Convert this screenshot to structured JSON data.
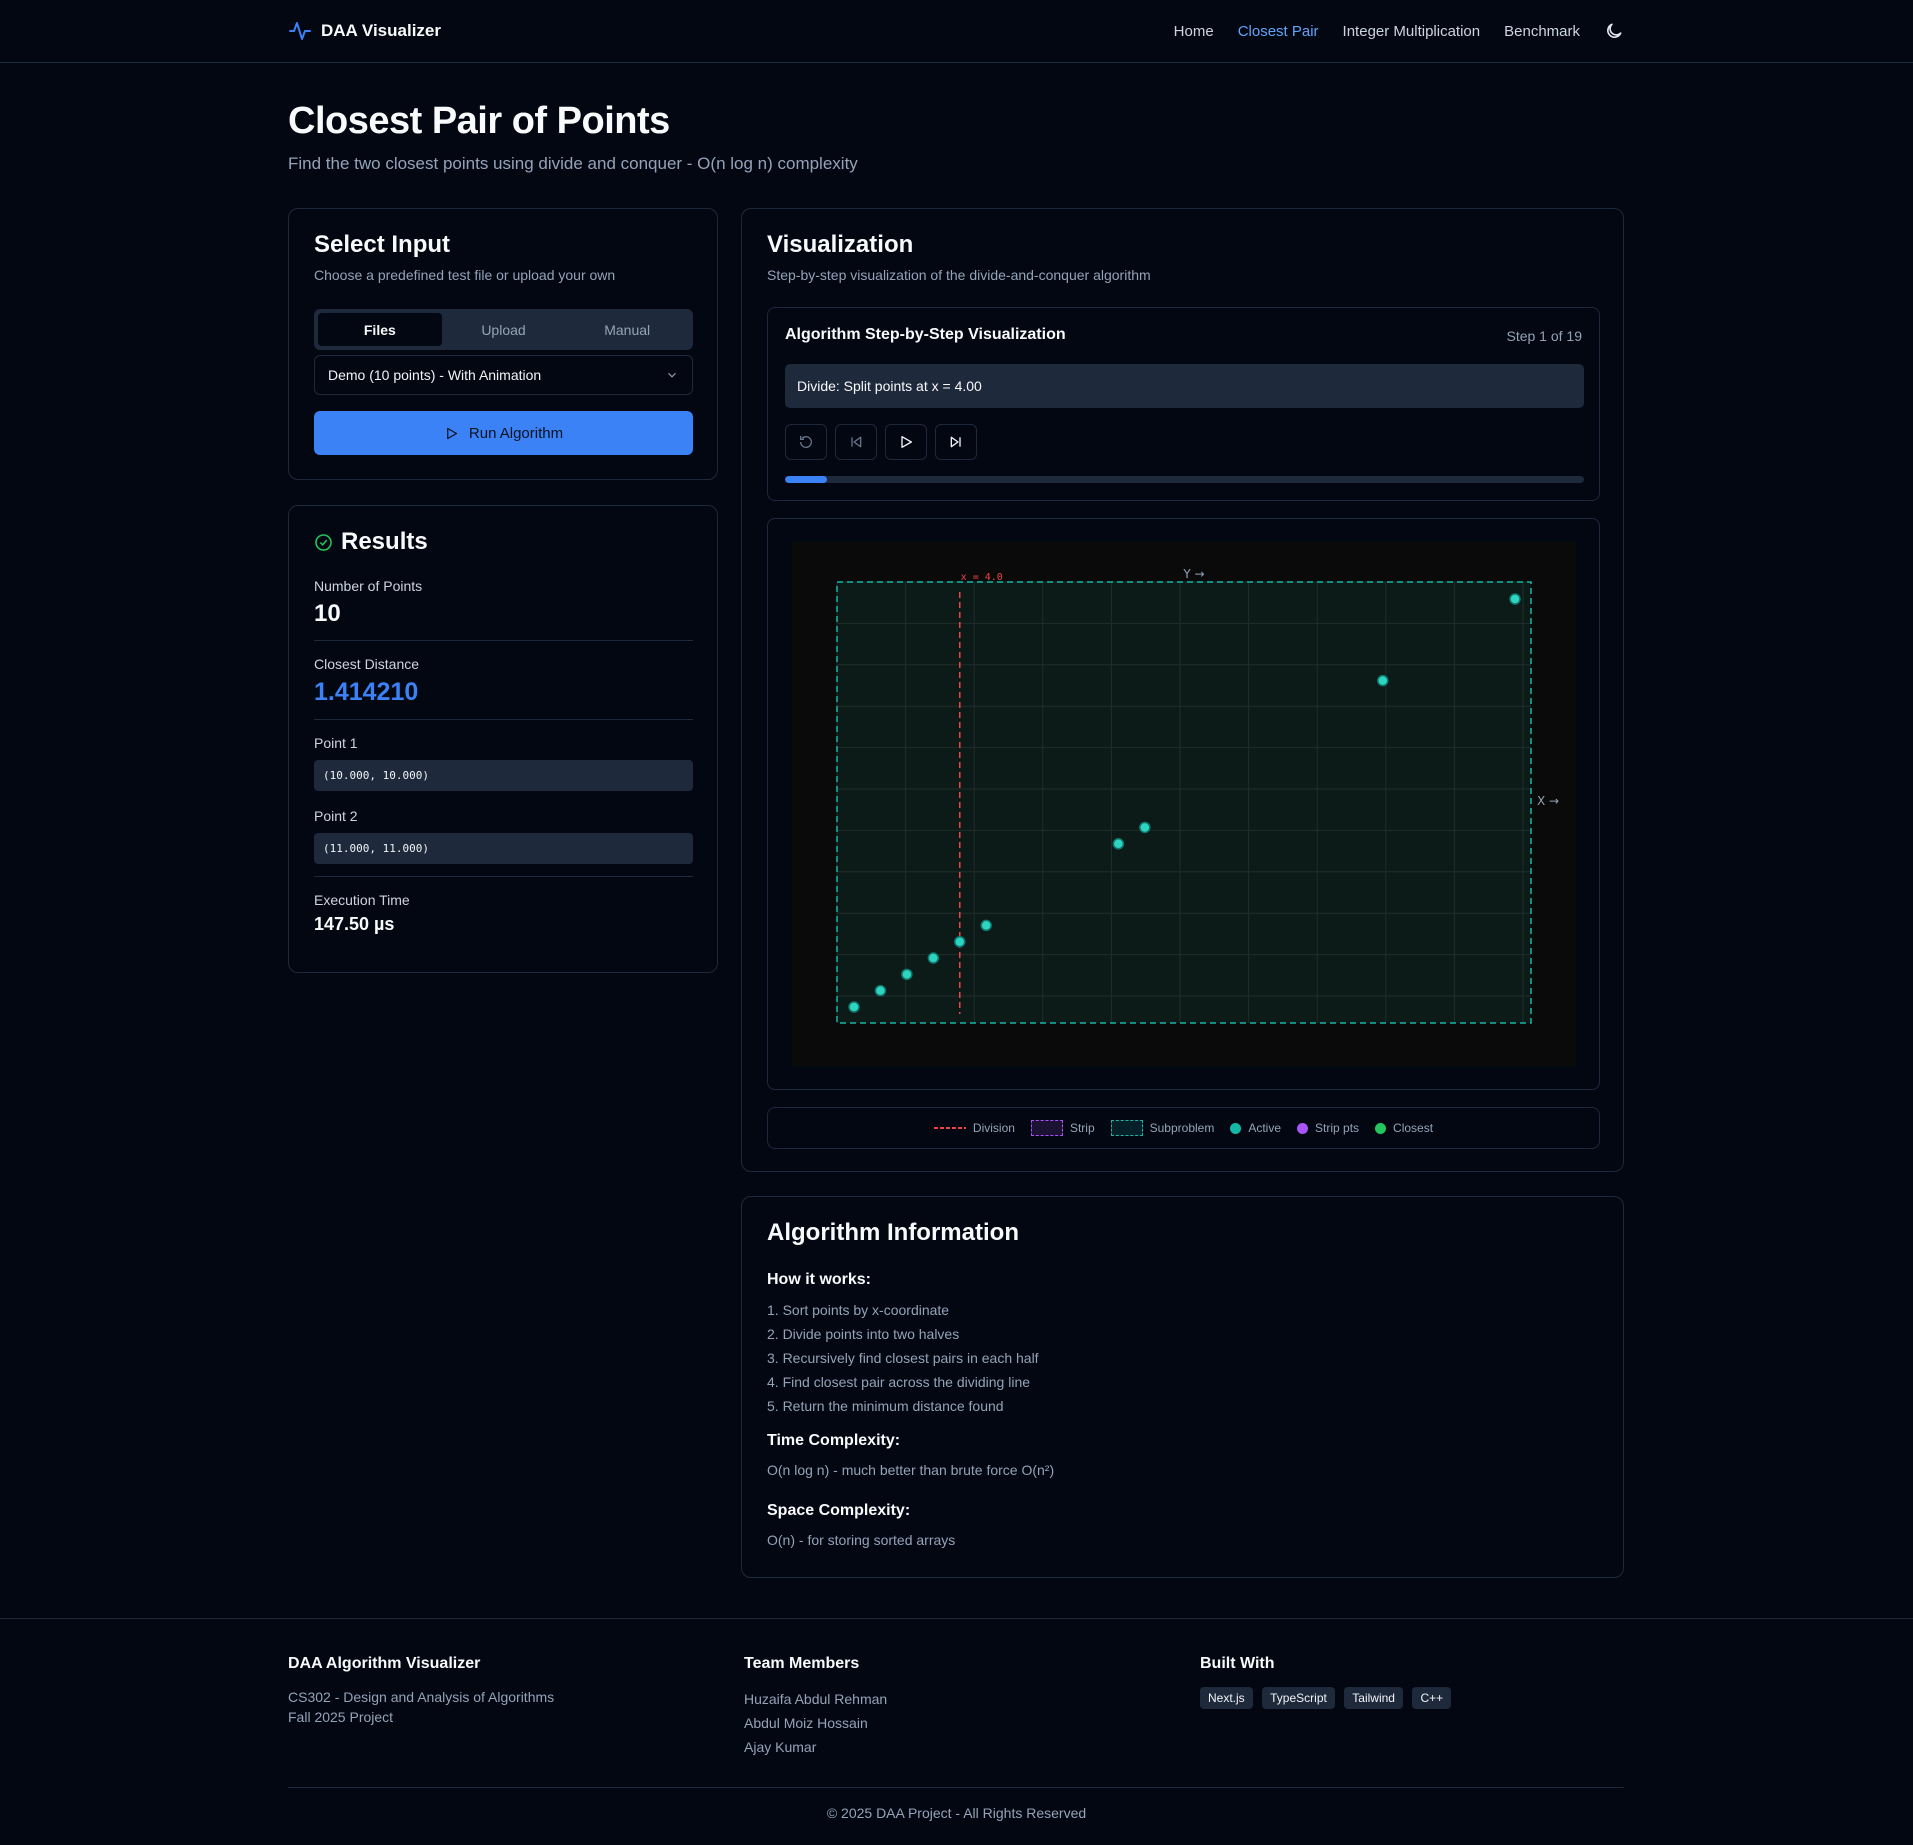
{
  "nav": {
    "brand": "DAA Visualizer",
    "links": [
      "Home",
      "Closest Pair",
      "Integer Multiplication",
      "Benchmark"
    ],
    "active": "Closest Pair"
  },
  "page": {
    "title": "Closest Pair of Points",
    "subtitle": "Find the two closest points using divide and conquer - O(n log n) complexity"
  },
  "input": {
    "title": "Select Input",
    "desc": "Choose a predefined test file or upload your own",
    "tabs": [
      "Files",
      "Upload",
      "Manual"
    ],
    "active_tab": "Files",
    "selected_file": "Demo (10 points) - With Animation",
    "run_label": "Run Algorithm"
  },
  "results": {
    "title": "Results",
    "num_points_label": "Number of Points",
    "num_points": "10",
    "distance_label": "Closest Distance",
    "distance": "1.414210",
    "p1_label": "Point 1",
    "p1": "(10.000, 10.000)",
    "p2_label": "Point 2",
    "p2": "(11.000, 11.000)",
    "time_label": "Execution Time",
    "time": "147.50 µs"
  },
  "viz": {
    "title": "Visualization",
    "desc": "Step-by-step visualization of the divide-and-conquer algorithm",
    "panel_title": "Algorithm Step-by-Step Visualization",
    "step_label": "Step 1 of 19",
    "step_message": "Divide: Split points at x = 4.00",
    "progress": 0.0526,
    "controls": [
      "reset-icon",
      "step-back-icon",
      "play-icon",
      "step-forward-icon"
    ]
  },
  "chart_data": {
    "type": "scatter",
    "division_label": "x = 4.0",
    "y_axis_label": "Y →",
    "x_axis_label": "X →",
    "division_x": 4.0,
    "points": [
      {
        "x": 0.0,
        "y": 0.0
      },
      {
        "x": 1.0,
        "y": 1.0
      },
      {
        "x": 2.0,
        "y": 2.0
      },
      {
        "x": 3.0,
        "y": 3.0
      },
      {
        "x": 4.0,
        "y": 4.0
      },
      {
        "x": 5.0,
        "y": 5.0
      },
      {
        "x": 10.0,
        "y": 10.0
      },
      {
        "x": 11.0,
        "y": 11.0
      },
      {
        "x": 20.0,
        "y": 20.0
      },
      {
        "x": 25.0,
        "y": 25.0
      }
    ],
    "xlim": [
      0,
      25
    ],
    "ylim": [
      0,
      25
    ],
    "colors": {
      "division": "#ef4444",
      "subproblem": "#14b8a6",
      "active": "#2dd4bf",
      "strip": "#a855f7",
      "closest": "#22c55e"
    }
  },
  "legend": [
    {
      "label": "Division"
    },
    {
      "label": "Strip"
    },
    {
      "label": "Subproblem"
    },
    {
      "label": "Active"
    },
    {
      "label": "Strip pts"
    },
    {
      "label": "Closest"
    }
  ],
  "algo": {
    "title": "Algorithm Information",
    "how_title": "How it works:",
    "steps": [
      "1. Sort points by x-coordinate",
      "2. Divide points into two halves",
      "3. Recursively find closest pairs in each half",
      "4. Find closest pair across the dividing line",
      "5. Return the minimum distance found"
    ],
    "time_title": "Time Complexity:",
    "time_text": "O(n log n) - much better than brute force O(n²)",
    "space_title": "Space Complexity:",
    "space_text": "O(n) - for storing sorted arrays"
  },
  "footer": {
    "col1_title": "DAA Algorithm Visualizer",
    "col1_line1": "CS302 - Design and Analysis of Algorithms",
    "col1_line2": "Fall 2025 Project",
    "col2_title": "Team Members",
    "members": [
      "Huzaifa Abdul Rehman",
      "Abdul Moiz Hossain",
      "Ajay Kumar"
    ],
    "col3_title": "Built With",
    "tech": [
      "Next.js",
      "TypeScript",
      "Tailwind",
      "C++"
    ],
    "copyright": "© 2025 DAA Project - All Rights Reserved"
  }
}
